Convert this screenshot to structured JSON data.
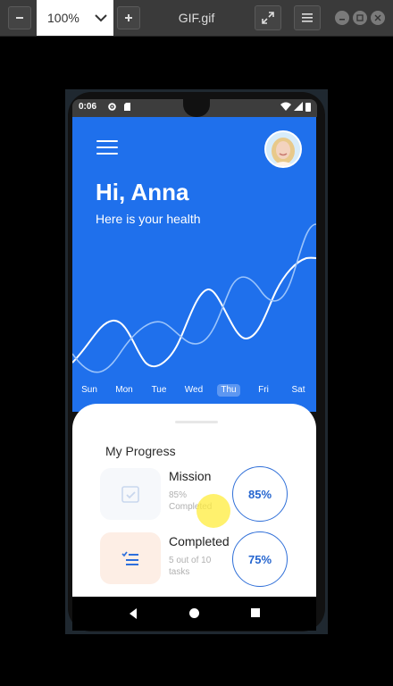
{
  "viewer": {
    "zoom": "100%",
    "title": "GIF.gif"
  },
  "status_bar": {
    "time": "0:06"
  },
  "app": {
    "greeting": "Hi, Anna",
    "subtitle": "Here is your health",
    "days": [
      "Sun",
      "Mon",
      "Tue",
      "Wed",
      "Thu",
      "Fri",
      "Sat"
    ],
    "active_day": "Thu",
    "progress": {
      "title": "My Progress",
      "cards": [
        {
          "title": "Mission",
          "subtitle": "85% Completed",
          "percent_label": "85%",
          "percent": 85,
          "icon": "calendar-check-icon"
        },
        {
          "title": "Completed",
          "subtitle": "5 out of 10 tasks",
          "percent_label": "75%",
          "percent": 75,
          "icon": "task-list-icon"
        }
      ]
    }
  },
  "colors": {
    "primary_blue": "#1f70ec",
    "ring_blue": "#2f6fd8",
    "task_icon_bg": "#fdeee5",
    "tap_indicator": "#ffec3c"
  }
}
